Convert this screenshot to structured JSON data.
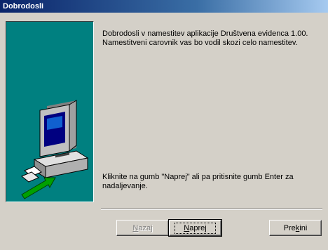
{
  "window": {
    "title": "Dobrodosli"
  },
  "intro": {
    "line1": "Dobrodosli v namestitev aplikacije Društvena evidenca 1.00.",
    "line2": "Namestitveni carovnik vas bo vodil skozi celo namestitev."
  },
  "instruction": {
    "line1": "Kliknite na gumb \"Naprej\" ali pa pritisnite gumb Enter za",
    "line2": "nadaljevanje."
  },
  "buttons": {
    "back": {
      "pre": "",
      "key": "N",
      "post": "azaj"
    },
    "next": {
      "pre": "",
      "key": "N",
      "post": "aprej"
    },
    "cancel": {
      "pre": "Pre",
      "key": "k",
      "post": "ini"
    }
  },
  "colors": {
    "panel": "#008080",
    "titlebar": "#0a246a",
    "face": "#d4d0c8"
  }
}
